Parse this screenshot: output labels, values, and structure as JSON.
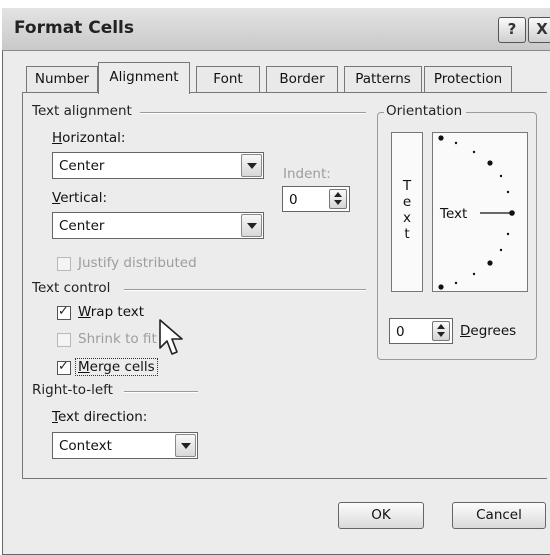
{
  "window": {
    "title": "Format Cells",
    "help_button": "?",
    "close_button": "X"
  },
  "tabs": [
    {
      "label": "Number",
      "active": false
    },
    {
      "label": "Alignment",
      "active": true
    },
    {
      "label": "Font",
      "active": false
    },
    {
      "label": "Border",
      "active": false
    },
    {
      "label": "Patterns",
      "active": false
    },
    {
      "label": "Protection",
      "active": false
    }
  ],
  "text_alignment": {
    "group_label": "Text alignment",
    "horizontal_label": "Horizontal:",
    "horizontal_value": "Center",
    "vertical_label": "Vertical:",
    "vertical_value": "Center",
    "indent_label": "Indent:",
    "indent_value": "0",
    "justify_distributed": {
      "label": "Justify distributed",
      "checked": false,
      "enabled": false
    }
  },
  "text_control": {
    "group_label": "Text control",
    "wrap_text": {
      "label": "Wrap text",
      "checked": true,
      "enabled": true
    },
    "shrink_to_fit": {
      "label": "Shrink to fit",
      "checked": false,
      "enabled": false
    },
    "merge_cells": {
      "label": "Merge cells",
      "checked": true,
      "enabled": true
    }
  },
  "right_to_left": {
    "group_label": "Right-to-left",
    "direction_label": "Text direction:",
    "direction_value": "Context"
  },
  "orientation": {
    "group_label": "Orientation",
    "vertical_text": "Text",
    "dial_text": "Text",
    "degrees_value": "0",
    "degrees_label": "Degrees"
  },
  "buttons": {
    "ok": "OK",
    "cancel": "Cancel"
  },
  "icons": {
    "help": "help-icon",
    "close": "close-icon",
    "dropdown": "chevron-down-icon",
    "spinner": "spinner-icon",
    "cursor": "mouse-pointer-icon"
  }
}
